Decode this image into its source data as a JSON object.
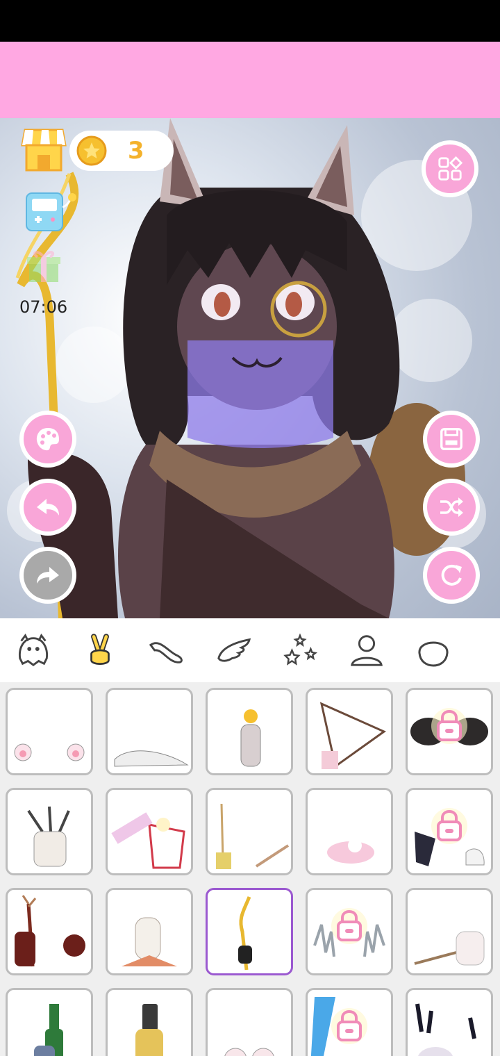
{
  "coins": {
    "count": "3"
  },
  "gift": {
    "timer": "07:06"
  },
  "tabs": [
    {
      "name": "tab-body",
      "icon": "creature-icon"
    },
    {
      "name": "tab-hands",
      "icon": "peace-hand-icon"
    },
    {
      "name": "tab-tail",
      "icon": "tail-icon"
    },
    {
      "name": "tab-wings",
      "icon": "wing-icon"
    },
    {
      "name": "tab-effects",
      "icon": "stars-icon"
    },
    {
      "name": "tab-person",
      "icon": "person-icon"
    },
    {
      "name": "tab-head",
      "icon": "head-icon"
    },
    {
      "name": "tab-more",
      "icon": "frame-icon"
    }
  ],
  "items": [
    {
      "name": "paws-pink",
      "locked": false,
      "selected": false
    },
    {
      "name": "paw-lying",
      "locked": false,
      "selected": false
    },
    {
      "name": "coin-flip",
      "locked": false,
      "selected": false
    },
    {
      "name": "folding-fan",
      "locked": false,
      "selected": false
    },
    {
      "name": "dark-fists",
      "locked": true,
      "selected": false
    },
    {
      "name": "bandaged-claw",
      "locked": false,
      "selected": false
    },
    {
      "name": "popcorn",
      "locked": false,
      "selected": false
    },
    {
      "name": "arrow-and-knife",
      "locked": false,
      "selected": false
    },
    {
      "name": "pink-bird",
      "locked": false,
      "selected": false
    },
    {
      "name": "gauntlets",
      "locked": true,
      "selected": false
    },
    {
      "name": "antler-staff",
      "locked": false,
      "selected": false
    },
    {
      "name": "white-bird",
      "locked": false,
      "selected": false
    },
    {
      "name": "golden-staff",
      "locked": false,
      "selected": true
    },
    {
      "name": "crystal-claws",
      "locked": true,
      "selected": false
    },
    {
      "name": "pipe-paws",
      "locked": false,
      "selected": false
    },
    {
      "name": "bottle",
      "locked": false,
      "selected": false
    },
    {
      "name": "phone",
      "locked": false,
      "selected": false
    },
    {
      "name": "paws-up",
      "locked": false,
      "selected": false
    },
    {
      "name": "ice-blade",
      "locked": true,
      "selected": false
    },
    {
      "name": "black-claws",
      "locked": false,
      "selected": false
    }
  ],
  "colors": {
    "accent_pink": "#f9a6d8",
    "banner_pink": "#ffa8e2",
    "selected_border": "#9b59d0",
    "coin": "#f4b22c"
  }
}
